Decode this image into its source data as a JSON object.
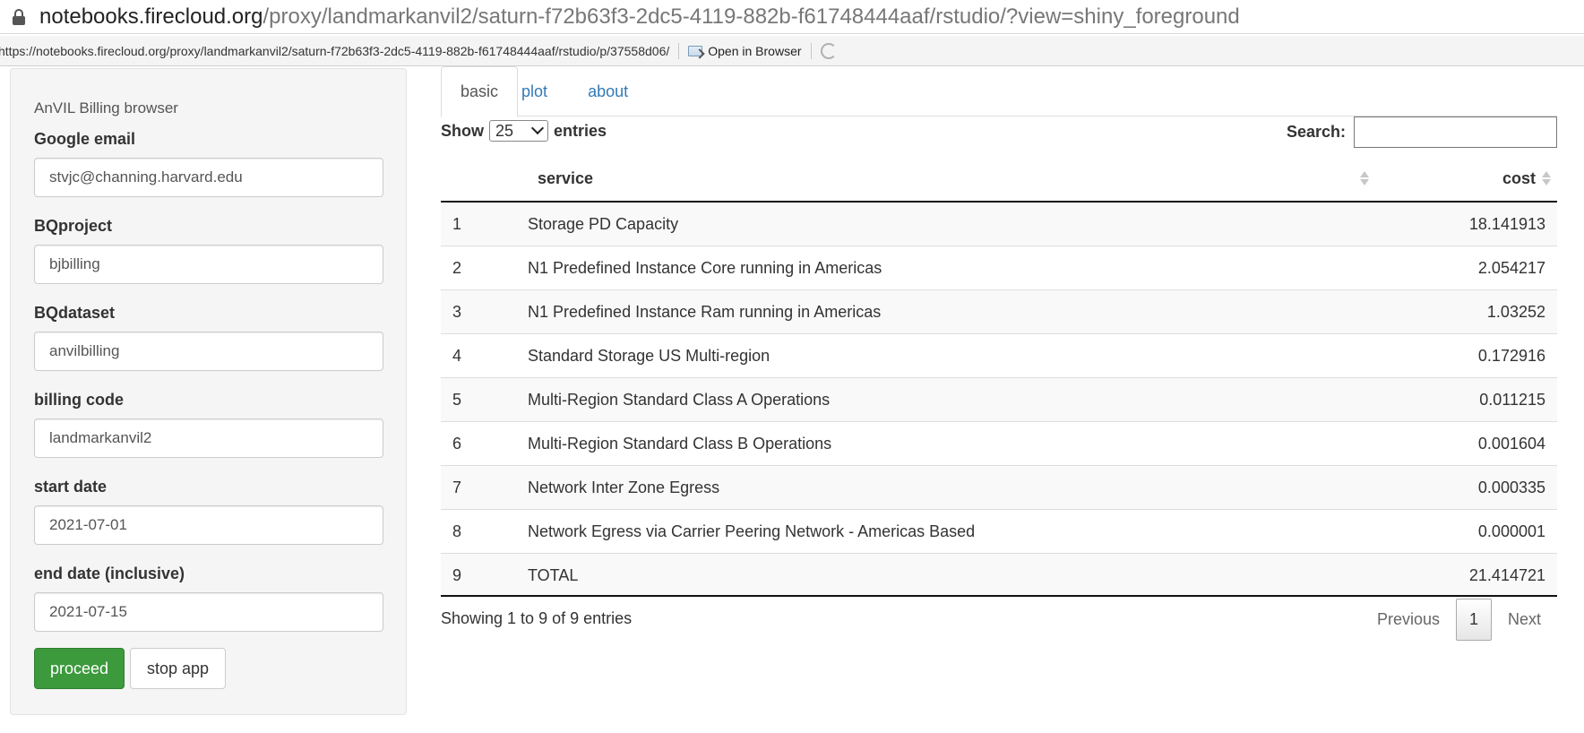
{
  "browser": {
    "url_host": "notebooks.firecloud.org",
    "url_path": "/proxy/landmarkanvil2/saturn-f72b63f3-2dc5-4119-882b-f61748444aaf/rstudio/?view=shiny_foreground"
  },
  "viewer": {
    "url": "https://notebooks.firecloud.org/proxy/landmarkanvil2/saturn-f72b63f3-2dc5-4119-882b-f61748444aaf/rstudio/p/37558d06/",
    "open_in_browser": "Open in Browser"
  },
  "sidebar": {
    "title": "AnVIL Billing browser",
    "fields": [
      {
        "label": "Google email",
        "value": "stvjc@channing.harvard.edu"
      },
      {
        "label": "BQproject",
        "value": "bjbilling"
      },
      {
        "label": "BQdataset",
        "value": "anvilbilling"
      },
      {
        "label": "billing code",
        "value": "landmarkanvil2"
      },
      {
        "label": "start date",
        "value": "2021-07-01"
      },
      {
        "label": "end date (inclusive)",
        "value": "2021-07-15"
      }
    ],
    "proceed_label": "proceed",
    "stop_label": "stop app",
    "colors": {
      "proceed": "#3c9a3c"
    }
  },
  "tabs": [
    {
      "label": "basic",
      "active": true
    },
    {
      "label": "plot",
      "active": false
    },
    {
      "label": "about",
      "active": false
    }
  ],
  "table_controls": {
    "show_label": "Show",
    "entries_value": "25",
    "entries_label": "entries",
    "search_label": "Search:",
    "search_value": ""
  },
  "table": {
    "columns": [
      "service",
      "cost"
    ],
    "rows": [
      {
        "idx": "1",
        "service": "Storage PD Capacity",
        "cost": "18.141913"
      },
      {
        "idx": "2",
        "service": "N1 Predefined Instance Core running in Americas",
        "cost": "2.054217"
      },
      {
        "idx": "3",
        "service": "N1 Predefined Instance Ram running in Americas",
        "cost": "1.03252"
      },
      {
        "idx": "4",
        "service": "Standard Storage US Multi-region",
        "cost": "0.172916"
      },
      {
        "idx": "5",
        "service": "Multi-Region Standard Class A Operations",
        "cost": "0.011215"
      },
      {
        "idx": "6",
        "service": "Multi-Region Standard Class B Operations",
        "cost": "0.001604"
      },
      {
        "idx": "7",
        "service": "Network Inter Zone Egress",
        "cost": "0.000335"
      },
      {
        "idx": "8",
        "service": "Network Egress via Carrier Peering Network - Americas Based",
        "cost": "0.000001"
      },
      {
        "idx": "9",
        "service": "TOTAL",
        "cost": "21.414721"
      }
    ]
  },
  "pagination": {
    "info": "Showing 1 to 9 of 9 entries",
    "previous": "Previous",
    "current": "1",
    "next": "Next"
  }
}
